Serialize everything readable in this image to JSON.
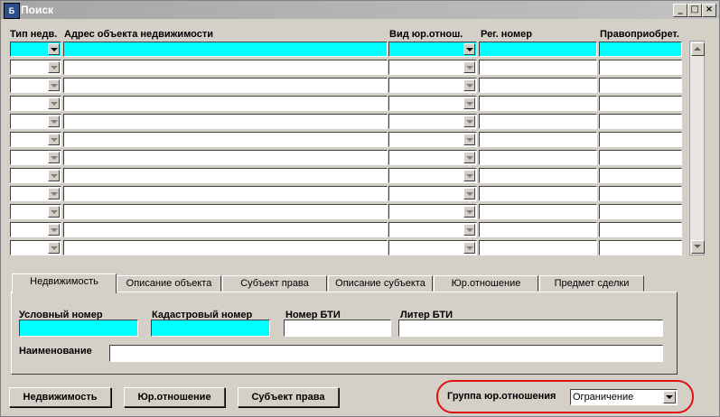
{
  "window": {
    "title": "Поиск",
    "icon": "app-icon",
    "controls": [
      "_",
      "□",
      "×"
    ]
  },
  "grid": {
    "headers": {
      "type": "Тип недв.",
      "address": "Адрес объекта недвижимости",
      "relation_kind": "Вид юр.отнош.",
      "reg_number": "Рег. номер",
      "rightholder": "Правоприобрет."
    },
    "row_count": 12
  },
  "tabs": [
    {
      "label": "Недвижимость",
      "active": true
    },
    {
      "label": "Описание объекта",
      "active": false
    },
    {
      "label": "Субъект права",
      "active": false
    },
    {
      "label": "Описание субъекта",
      "active": false
    },
    {
      "label": "Юр.отношение",
      "active": false
    },
    {
      "label": "Предмет сделки",
      "active": false
    }
  ],
  "form": {
    "conditional_number_label": "Условный номер",
    "cadastral_number_label": "Кадастровый номер",
    "bti_number_label": "Номер БТИ",
    "bti_letter_label": "Литер БТИ",
    "name_label": "Наименование"
  },
  "buttons": {
    "property": "Недвижимость",
    "legal_relation": "Юр.отношение",
    "subject": "Субъект права"
  },
  "group": {
    "label": "Группа юр.отношения",
    "selected": "Ограничение"
  },
  "colors": {
    "highlight": "#00ffff",
    "annotation": "#e01010"
  }
}
